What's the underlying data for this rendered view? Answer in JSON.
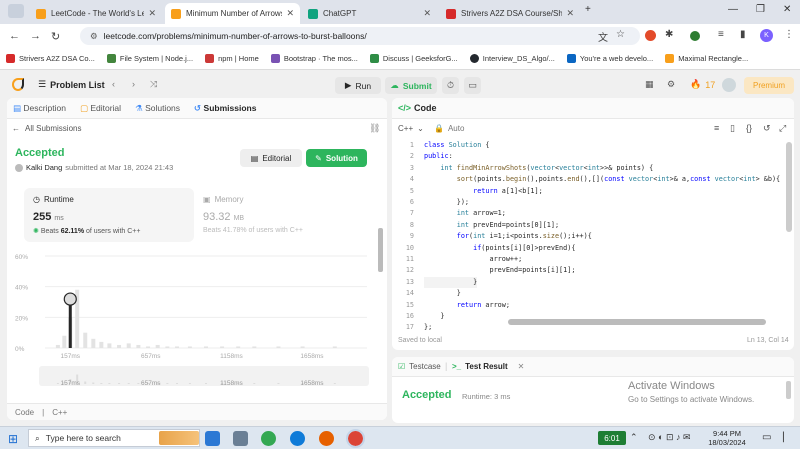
{
  "browser": {
    "tabs": [
      {
        "title": "LeetCode - The World's Leading",
        "favicon_color": "#f89f1b",
        "active": false
      },
      {
        "title": "Minimum Number of Arrows to",
        "favicon_color": "#f89f1b",
        "active": true
      },
      {
        "title": "ChatGPT",
        "favicon_color": "#10a37f",
        "active": false
      },
      {
        "title": "Strivers A2Z DSA Course/Sheet",
        "favicon_color": "#d62a2a",
        "active": false
      }
    ],
    "url": "leetcode.com/problems/minimum-number-of-arrows-to-burst-balloons/",
    "profile_initial": "K",
    "bookmarks": [
      {
        "label": "Strivers A2Z DSA Co...",
        "color": "#d62a2a"
      },
      {
        "label": "File System | Node.j...",
        "color": "#43853d"
      },
      {
        "label": "npm | Home",
        "color": "#cb3837"
      },
      {
        "label": "Bootstrap · The mos...",
        "color": "#7952b3"
      },
      {
        "label": "Discuss | GeeksforG...",
        "color": "#2f8d46"
      },
      {
        "label": "Interview_DS_Algo/...",
        "color": "#24292f"
      },
      {
        "label": "You're a web develo...",
        "color": "#0a66c2"
      },
      {
        "label": "Maximal Rectangle...",
        "color": "#f89f1b"
      }
    ]
  },
  "header": {
    "problem_list": "Problem List",
    "run": "Run",
    "submit": "Submit",
    "streak": "17",
    "premium": "Premium"
  },
  "left": {
    "tabs": [
      "Description",
      "Editorial",
      "Solutions",
      "Submissions"
    ],
    "back": "All Submissions",
    "status": "Accepted",
    "author": "Kalki Dang",
    "submitted": "submitted at Mar 18, 2024 21:43",
    "editorial_btn": "Editorial",
    "solution_btn": "Solution",
    "runtime_label": "Runtime",
    "runtime_value": "255",
    "runtime_unit": "ms",
    "runtime_beats_prefix": "Beats",
    "runtime_beats": "62.11%",
    "runtime_beats_suffix": "of users with C++",
    "memory_label": "Memory",
    "memory_value": "93.32",
    "memory_unit": "MB",
    "memory_beats": "Beats 41.78% of users with C++",
    "footer_code": "Code",
    "footer_lang": "C++"
  },
  "chart_data": {
    "type": "bar",
    "y_ticks": [
      "60%",
      "40%",
      "20%",
      "0%"
    ],
    "x_ticks": [
      "157ms",
      "657ms",
      "1158ms",
      "1658ms"
    ],
    "ylim": [
      0,
      60
    ],
    "xlim": [
      0,
      2000
    ],
    "bars": [
      {
        "x": 80,
        "y": 2
      },
      {
        "x": 120,
        "y": 8
      },
      {
        "x": 157,
        "y": 20
      },
      {
        "x": 200,
        "y": 38
      },
      {
        "x": 250,
        "y": 10
      },
      {
        "x": 300,
        "y": 6
      },
      {
        "x": 350,
        "y": 4
      },
      {
        "x": 400,
        "y": 3
      },
      {
        "x": 460,
        "y": 2
      },
      {
        "x": 520,
        "y": 3
      },
      {
        "x": 580,
        "y": 2
      },
      {
        "x": 640,
        "y": 1
      },
      {
        "x": 700,
        "y": 2
      },
      {
        "x": 760,
        "y": 1
      },
      {
        "x": 820,
        "y": 1
      },
      {
        "x": 900,
        "y": 1
      },
      {
        "x": 1000,
        "y": 1
      },
      {
        "x": 1100,
        "y": 1
      },
      {
        "x": 1200,
        "y": 1
      },
      {
        "x": 1300,
        "y": 1
      },
      {
        "x": 1450,
        "y": 1
      },
      {
        "x": 1600,
        "y": 1
      },
      {
        "x": 1800,
        "y": 1
      }
    ],
    "highlight": {
      "x": 157,
      "y": 28
    }
  },
  "code": {
    "lang": "C++",
    "mode": "Auto",
    "saved": "Saved to local",
    "cursor": "Ln 13, Col 14",
    "lines": [
      "class Solution {",
      "public:",
      "    int findMinArrowShots(vector<vector<int>>& points) {",
      "        sort(points.begin(),points.end(),[](const vector<int>& a,const vector<int> &b){",
      "            return a[1]<b[1];",
      "        });",
      "        int arrow=1;",
      "        int prevEnd=points[0][1];",
      "        for(int i=1;i<points.size();i++){",
      "            if(points[i][0]>prevEnd){",
      "                arrow++;",
      "                prevEnd=points[i][1];",
      "            }",
      "        }",
      "        return arrow;",
      "    }",
      "};"
    ]
  },
  "test": {
    "testcase_tab": "Testcase",
    "result_tab": "Test Result",
    "status": "Accepted",
    "runtime": "Runtime: 3 ms",
    "watermark_title": "Activate Windows",
    "watermark_sub": "Go to Settings to activate Windows."
  },
  "taskbar": {
    "search_placeholder": "Type here to search",
    "clock_badge": "6:01",
    "time": "9:44 PM",
    "date": "18/03/2024"
  }
}
